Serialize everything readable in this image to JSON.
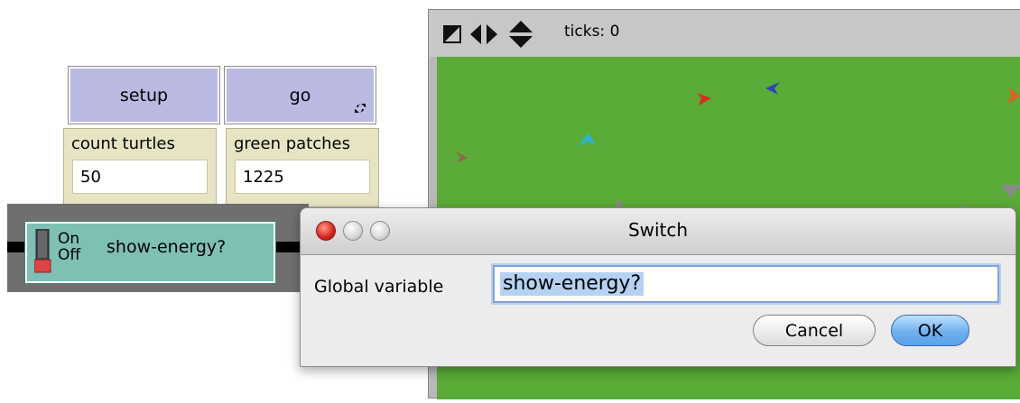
{
  "buttons": {
    "setup_label": "setup",
    "go_label": "go"
  },
  "monitors": [
    {
      "label": "count turtles",
      "value": "50"
    },
    {
      "label": "green patches",
      "value": "1225"
    }
  ],
  "switch": {
    "on_label": "On",
    "off_label": "Off",
    "label": "show-energy?"
  },
  "view": {
    "ticks_label": "ticks: 0",
    "world_color": "#5aab37"
  },
  "dialog": {
    "title": "Switch",
    "field_label": "Global variable",
    "field_value": "show-energy?",
    "cancel_label": "Cancel",
    "ok_label": "OK"
  },
  "icons": [
    "forever-icon",
    "world-size-icon",
    "horizontal-arrows-icon",
    "vertical-arrows-icon",
    "close-icon",
    "minimize-icon",
    "zoom-icon",
    "switch-toggle-icon"
  ]
}
